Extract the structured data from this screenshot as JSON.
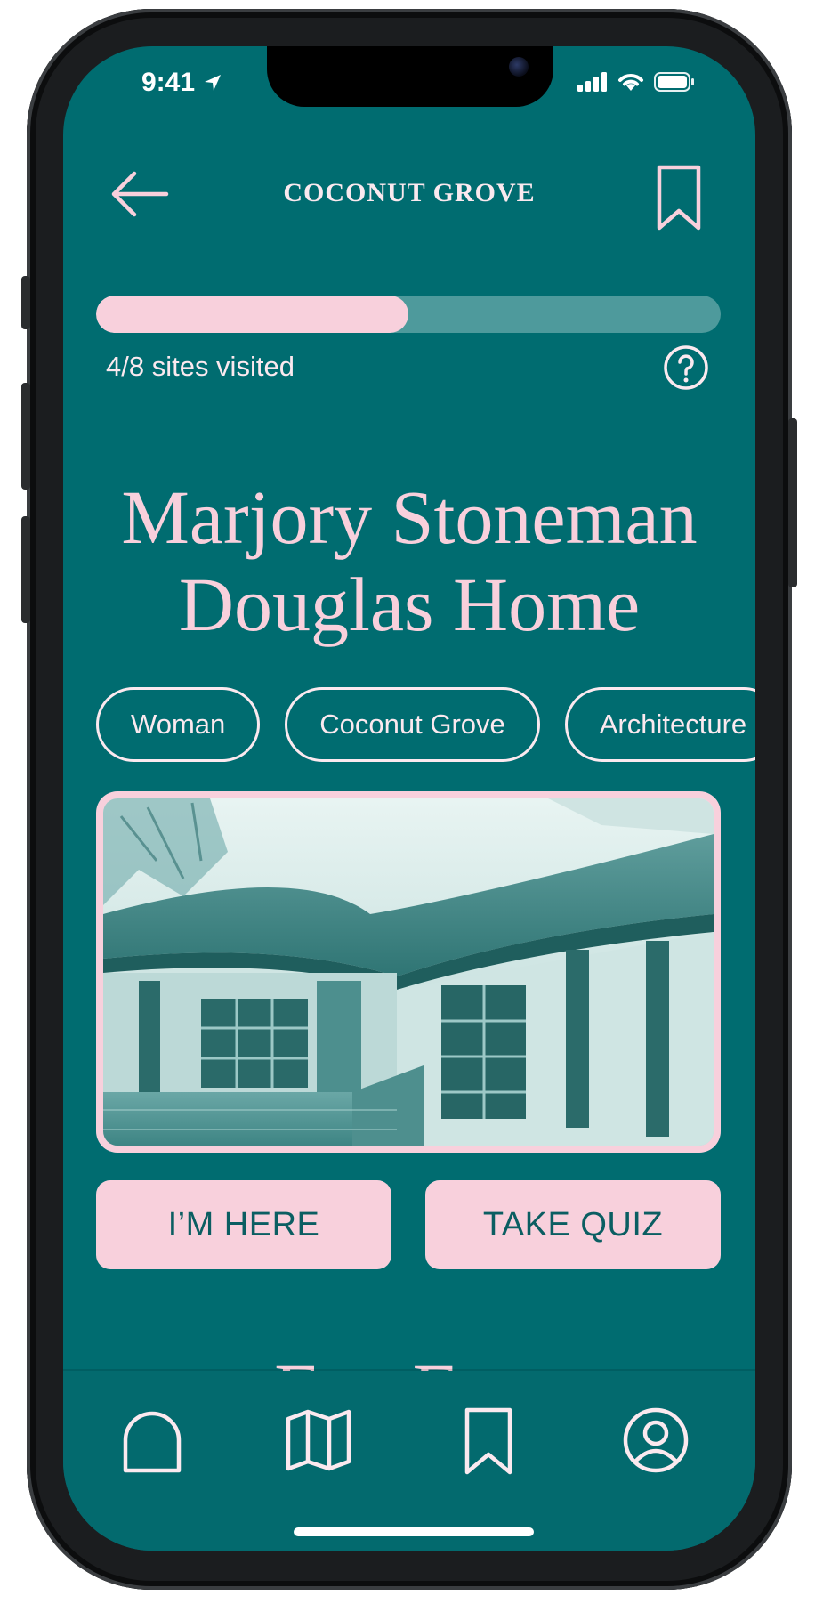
{
  "status_bar": {
    "time": "9:41"
  },
  "header": {
    "title": "COCONUT GROVE"
  },
  "progress": {
    "visited": 4,
    "total": 8,
    "fraction": 0.5,
    "label": "4/8 sites visited"
  },
  "site": {
    "title_line1": "Marjory Stoneman",
    "title_line2": "Douglas Home"
  },
  "tags": [
    "Woman",
    "Coconut Grove",
    "Architecture"
  ],
  "actions": {
    "im_here": "I’M HERE",
    "take_quiz": "TAKE QUIZ"
  },
  "next_section": {
    "title": "Fun Fact"
  },
  "tabbar": {
    "icons": [
      "home-icon",
      "map-icon",
      "bookmark-icon",
      "profile-icon"
    ]
  },
  "colors": {
    "background": "#006c70",
    "accent_pink": "#f8d0dc",
    "text_light": "#fbe9ef",
    "button_text": "#0b5e62"
  }
}
